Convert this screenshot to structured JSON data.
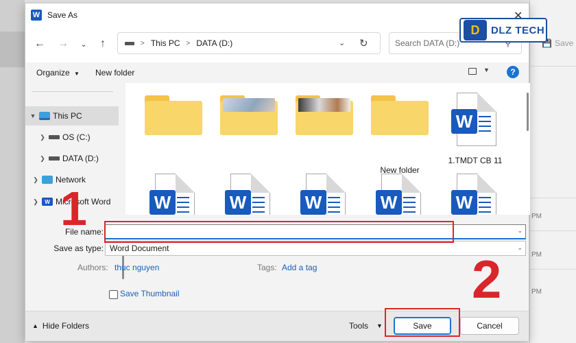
{
  "dialog": {
    "title": "Save As"
  },
  "nav": {
    "breadcrumb": [
      "This PC",
      "DATA (D:)"
    ],
    "search_placeholder": "Search DATA (D:)"
  },
  "toolbar": {
    "organize_label": "Organize",
    "new_folder_label": "New folder"
  },
  "sidebar": {
    "items": [
      {
        "label": "This PC",
        "icon": "computer-icon"
      },
      {
        "label": "OS (C:)",
        "icon": "drive-icon"
      },
      {
        "label": "DATA (D:)",
        "icon": "drive-icon"
      },
      {
        "label": "Network",
        "icon": "network-icon"
      },
      {
        "label": "Microsoft Word",
        "icon": "word-icon"
      }
    ]
  },
  "files": {
    "row1": [
      {
        "type": "folder",
        "name": ""
      },
      {
        "type": "folder-photo",
        "name": ""
      },
      {
        "type": "folder-photo",
        "name": ""
      },
      {
        "type": "folder",
        "name": "New folder"
      },
      {
        "type": "word-doc",
        "name": "1.TMDT CB 11"
      }
    ],
    "row2": [
      {
        "type": "word-doc",
        "name": ""
      },
      {
        "type": "word-doc",
        "name": ""
      },
      {
        "type": "word-doc",
        "name": ""
      },
      {
        "type": "word-doc",
        "name": ""
      },
      {
        "type": "word-doc",
        "name": ""
      }
    ]
  },
  "form": {
    "file_name_label": "File name:",
    "file_name_value": "",
    "save_type_label": "Save as type:",
    "save_type_value": "Word Document",
    "authors_label": "Authors:",
    "authors_value": "thuc nguyen",
    "tags_label": "Tags:",
    "tags_value": "Add a tag",
    "thumbnail_label": "Save Thumbnail",
    "thumbnail_checked": false
  },
  "footer": {
    "hide_folders_label": "Hide Folders",
    "tools_label": "Tools",
    "save_label": "Save",
    "cancel_label": "Cancel"
  },
  "annotations": {
    "step1": "1",
    "step2": "2"
  },
  "background": {
    "save_label": "Save",
    "pm_labels": [
      "PM",
      "PM",
      "PM"
    ]
  },
  "watermark": {
    "brand": "DLZ TECH"
  },
  "colors": {
    "accent": "#1a73d6",
    "word_blue": "#185abd",
    "annotation_red": "#d9262b",
    "folder_yellow": "#f8d66a"
  }
}
